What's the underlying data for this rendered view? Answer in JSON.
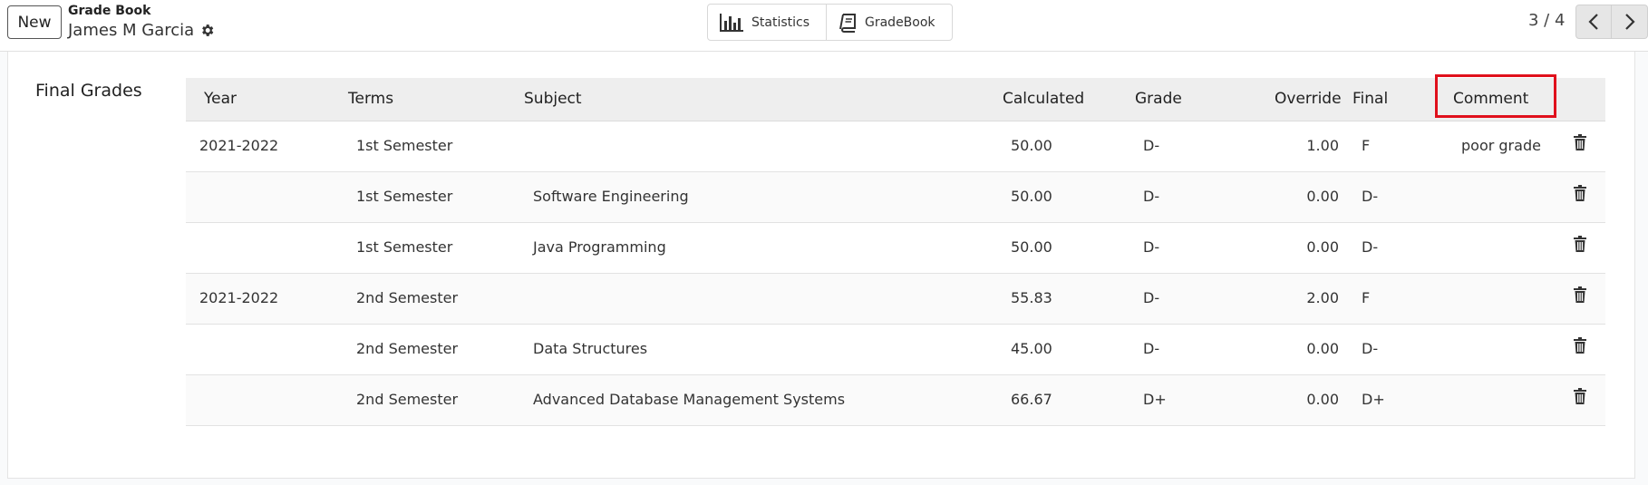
{
  "toolbar": {
    "new_label": "New",
    "breadcrumb_parent": "Grade Book",
    "record_title": "James M Garcia"
  },
  "smart_buttons": [
    {
      "label": "Statistics",
      "icon": "bar-chart-icon"
    },
    {
      "label": "GradeBook",
      "icon": "book-icon"
    }
  ],
  "pager": {
    "value": "3 / 4"
  },
  "section": {
    "label": "Final Grades"
  },
  "table": {
    "columns": {
      "year": "Year",
      "terms": "Terms",
      "subject": "Subject",
      "calculated": "Calculated",
      "grade": "Grade",
      "override": "Override",
      "final": "Final",
      "comment": "Comment"
    },
    "rows": [
      {
        "year": "2021-2022",
        "terms": "1st Semester",
        "subject": "",
        "calculated": "50.00",
        "grade": "D-",
        "override": "1.00",
        "final": "F",
        "comment": "poor grade"
      },
      {
        "year": "",
        "terms": "1st Semester",
        "subject": "Software Engineering",
        "calculated": "50.00",
        "grade": "D-",
        "override": "0.00",
        "final": "D-",
        "comment": ""
      },
      {
        "year": "",
        "terms": "1st Semester",
        "subject": "Java Programming",
        "calculated": "50.00",
        "grade": "D-",
        "override": "0.00",
        "final": "D-",
        "comment": ""
      },
      {
        "year": "2021-2022",
        "terms": "2nd Semester",
        "subject": "",
        "calculated": "55.83",
        "grade": "D-",
        "override": "2.00",
        "final": "F",
        "comment": ""
      },
      {
        "year": "",
        "terms": "2nd Semester",
        "subject": "Data Structures",
        "calculated": "45.00",
        "grade": "D-",
        "override": "0.00",
        "final": "D-",
        "comment": ""
      },
      {
        "year": "",
        "terms": "2nd Semester",
        "subject": "Advanced Database Management Systems",
        "calculated": "66.67",
        "grade": "D+",
        "override": "0.00",
        "final": "D+",
        "comment": ""
      }
    ]
  },
  "highlight_color": "#e0101c"
}
